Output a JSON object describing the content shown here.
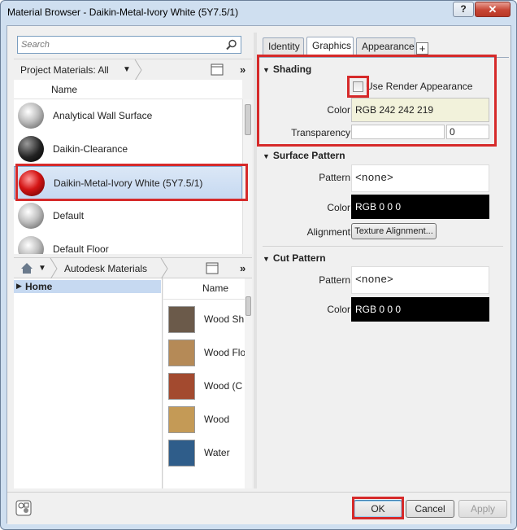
{
  "window": {
    "title": "Material Browser - Daikin-Metal-Ivory White (5Y7.5/1)",
    "help_label": "?",
    "close_label": "✕"
  },
  "search": {
    "placeholder": "Search"
  },
  "project": {
    "crumb_label": "Project Materials: All",
    "column_name": "Name",
    "materials": [
      {
        "label": "Analytical Wall Surface",
        "icon": "gray-sphere"
      },
      {
        "label": "Daikin-Clearance",
        "icon": "black-sphere"
      },
      {
        "label": "Daikin-Metal-Ivory White (5Y7.5/1)",
        "icon": "red-sphere",
        "selected": true
      },
      {
        "label": "Default",
        "icon": "gray-sphere"
      },
      {
        "label": "Default Floor",
        "icon": "gray-sphere"
      }
    ]
  },
  "library": {
    "crumb_label": "Autodesk Materials",
    "tree_root": "Home",
    "column_name": "Name",
    "items": [
      {
        "label": "Wood Sh",
        "color": "#6b5a4a"
      },
      {
        "label": "Wood Flo",
        "color": "#b58a57"
      },
      {
        "label": "Wood (C",
        "color": "#a34a2f"
      },
      {
        "label": "Wood",
        "color": "#c49a56"
      },
      {
        "label": "Water",
        "color": "#2f5d8a"
      }
    ]
  },
  "tabs": [
    "Identity",
    "Graphics",
    "Appearance"
  ],
  "tab_add_label": "+",
  "shading": {
    "title": "Shading",
    "use_render_label": "Use Render Appearance",
    "color_label": "Color",
    "color_value": "RGB 242 242 219",
    "color_hex": "#f2f2db",
    "transparency_label": "Transparency",
    "transparency_value": "0"
  },
  "surface_pattern": {
    "title": "Surface Pattern",
    "pattern_label": "Pattern",
    "pattern_value": "<none>",
    "color_label": "Color",
    "color_value": "RGB 0 0 0",
    "alignment_label": "Alignment",
    "alignment_button": "Texture Alignment..."
  },
  "cut_pattern": {
    "title": "Cut Pattern",
    "pattern_label": "Pattern",
    "pattern_value": "<none>",
    "color_label": "Color",
    "color_value": "RGB 0 0 0"
  },
  "buttons": {
    "ok": "OK",
    "cancel": "Cancel",
    "apply": "Apply"
  },
  "accent": {
    "highlight": "#d62a2a",
    "selection": "#c6d9f1"
  }
}
